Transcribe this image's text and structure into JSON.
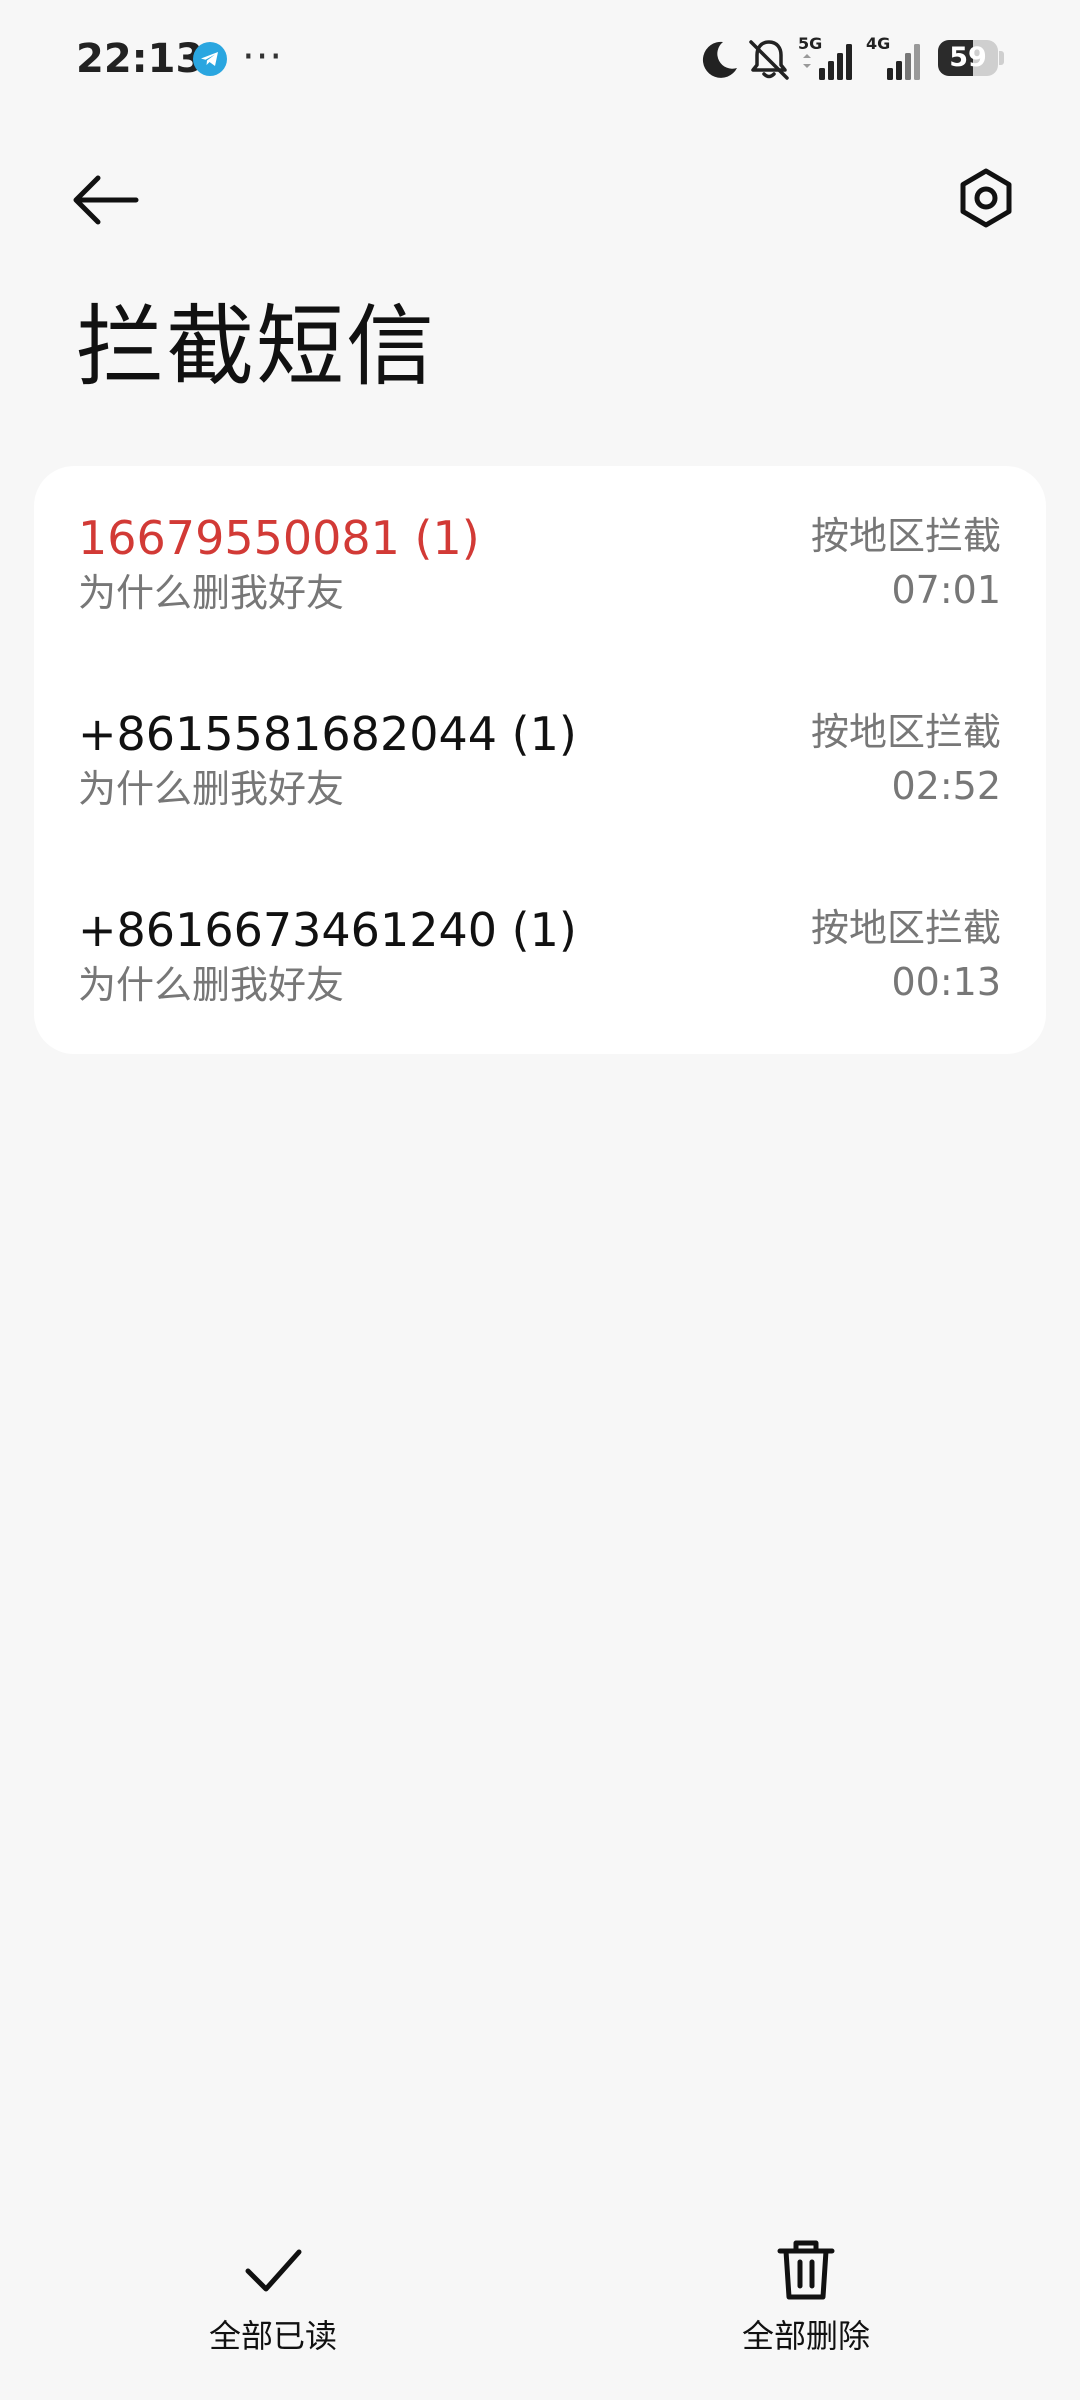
{
  "status_bar": {
    "time": "22:13",
    "left_icons": [
      "telegram-icon",
      "more-dots-icon"
    ],
    "more_text": "···",
    "right_icons": [
      "moon-icon",
      "mute-icon",
      "signal-5g-icon",
      "signal-4g-icon",
      "battery-icon"
    ],
    "signal_5g_label": "5G",
    "signal_4g_label": "4G",
    "battery_level": 59,
    "battery_text": "59"
  },
  "app_bar": {
    "back_icon": "back-arrow-icon",
    "settings_icon": "settings-hexagon-icon",
    "title": "拦截短信"
  },
  "messages": [
    {
      "sender": "16679550081 (1)",
      "preview": "为什么删我好友",
      "reason": "按地区拦截",
      "time": "07:01",
      "highlight_color": "#d23a36"
    },
    {
      "sender": "+8615581682044 (1)",
      "preview": "为什么删我好友",
      "reason": "按地区拦截",
      "time": "02:52"
    },
    {
      "sender": "+8616673461240 (1)",
      "preview": "为什么删我好友",
      "reason": "按地区拦截",
      "time": "00:13"
    }
  ],
  "bottom_bar": {
    "mark_all_read_label": "全部已读",
    "mark_all_read_icon": "checkmark-icon",
    "delete_all_label": "全部删除",
    "delete_all_icon": "trash-icon"
  },
  "colors": {
    "background": "#f7f7f7",
    "card": "#ffffff",
    "unread_sender": "#d23a36",
    "secondary_text": "#777777"
  }
}
